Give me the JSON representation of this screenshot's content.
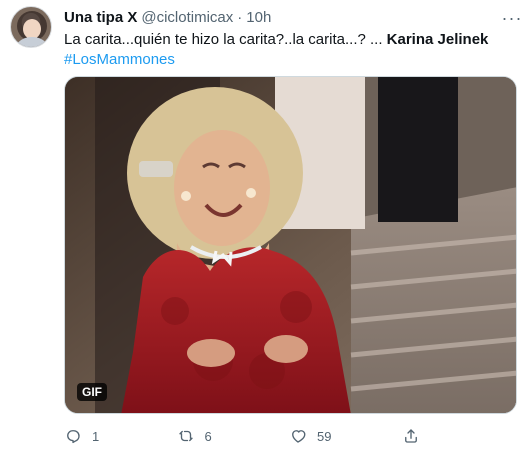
{
  "tweet": {
    "display_name": "Una tipa X",
    "handle": "@ciclotimicax",
    "separator": "·",
    "time": "10h",
    "text_main": "La carita...quién te hizo la carita?..la carita...?  ...  ",
    "text_bold": "Karina Jelinek",
    "hashtag": "#LosMammones",
    "media_badge": "GIF",
    "more_label": "···"
  },
  "actions": {
    "reply_count": "1",
    "retweet_count": "6",
    "like_count": "59",
    "reply_icon": "reply-icon",
    "retweet_icon": "retweet-icon",
    "like_icon": "heart-icon",
    "share_icon": "share-icon"
  },
  "colors": {
    "text_primary": "#0f1419",
    "text_secondary": "#536471",
    "link": "#1d9bf0",
    "border": "#cfd9de"
  }
}
